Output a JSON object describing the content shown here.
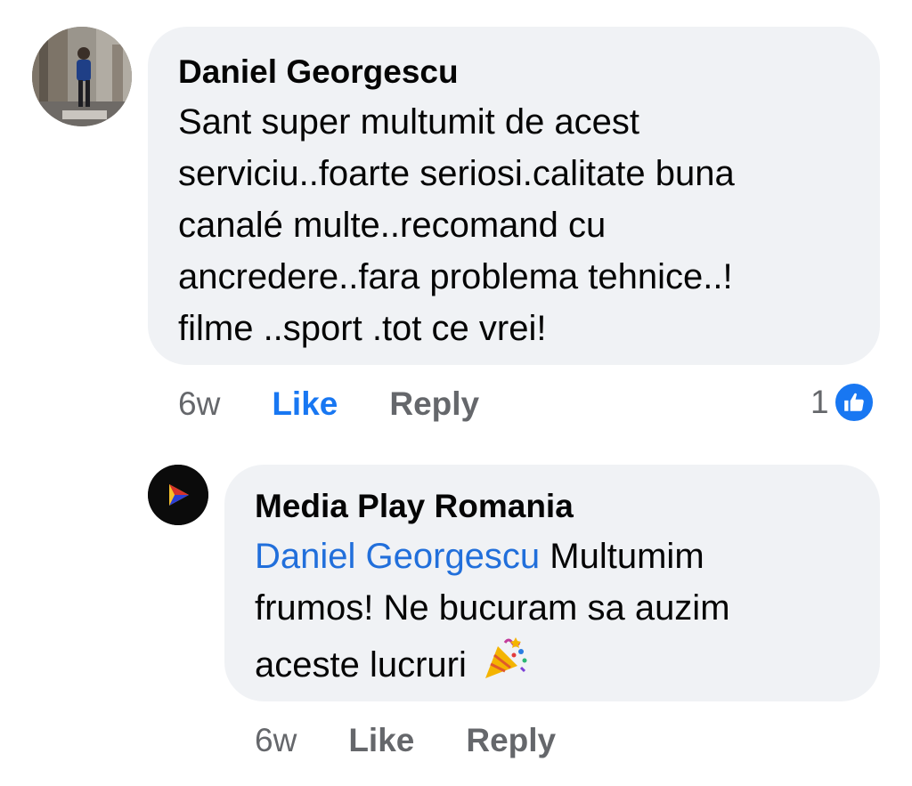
{
  "comment": {
    "author": "Daniel Georgescu",
    "text_lines": [
      "Sant super multumit de acest",
      "serviciu..foarte seriosi.calitate buna",
      "canalé multe..recomand cu",
      "ancredere..fara problema tehnice..!",
      "filme ..sport .tot ce vrei!"
    ],
    "time": "6w",
    "like_label": "Like",
    "like_state": "liked",
    "reply_label": "Reply",
    "reaction_count": "1",
    "reaction_icon": "thumbs-up-icon"
  },
  "reply": {
    "author": "Media Play Romania",
    "mention": "Daniel Georgescu",
    "text_lines": [
      " Multumim",
      "frumos! Ne bucuram sa auzim",
      "aceste lucruri "
    ],
    "emoji": "party-popper-icon",
    "time": "6w",
    "like_label": "Like",
    "reply_label": "Reply"
  },
  "colors": {
    "bubble": "#f0f2f5",
    "accent_blue": "#1877f2",
    "mention_blue": "#216fdb",
    "secondary_text": "#65676b"
  }
}
